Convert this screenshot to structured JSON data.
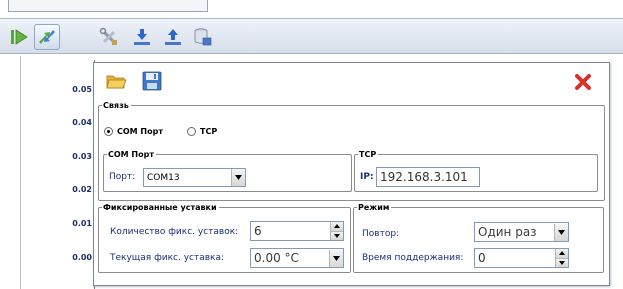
{
  "chart": {
    "y_ticks": [
      "0.05",
      "0.04",
      "0.03",
      "0.02",
      "0.01",
      "0.00"
    ]
  },
  "toolbar": {
    "icons": [
      "play-icon",
      "connect-arrows-icon",
      "tools-icon",
      "download-icon",
      "upload-icon",
      "database-save-icon"
    ]
  },
  "dialog": {
    "open_icon": "folder-open-icon",
    "save_icon": "floppy-save-icon",
    "close_icon": "close-icon",
    "close_color": "#d8322a",
    "connection": {
      "title": "Связь",
      "options": [
        {
          "label": "COM Порт",
          "selected": true
        },
        {
          "label": "TCP",
          "selected": false
        }
      ]
    },
    "com_port": {
      "title": "COM Порт",
      "port_label": "Порт:",
      "port_value": "COM13"
    },
    "tcp": {
      "title": "TCP",
      "ip_label": "IP:",
      "ip_value": "192.168.3.101"
    },
    "fixed_setpoints": {
      "title": "Фиксированные уставки",
      "count_label": "Количество фикс. уставок:",
      "count_value": "6",
      "current_label": "Текущая фикс. уставка:",
      "current_value": "0.00 °C"
    },
    "mode": {
      "title": "Режим",
      "repeat_label": "Повтор:",
      "repeat_value": "Один раз",
      "hold_label": "Время поддержания:",
      "hold_value": "0"
    }
  }
}
